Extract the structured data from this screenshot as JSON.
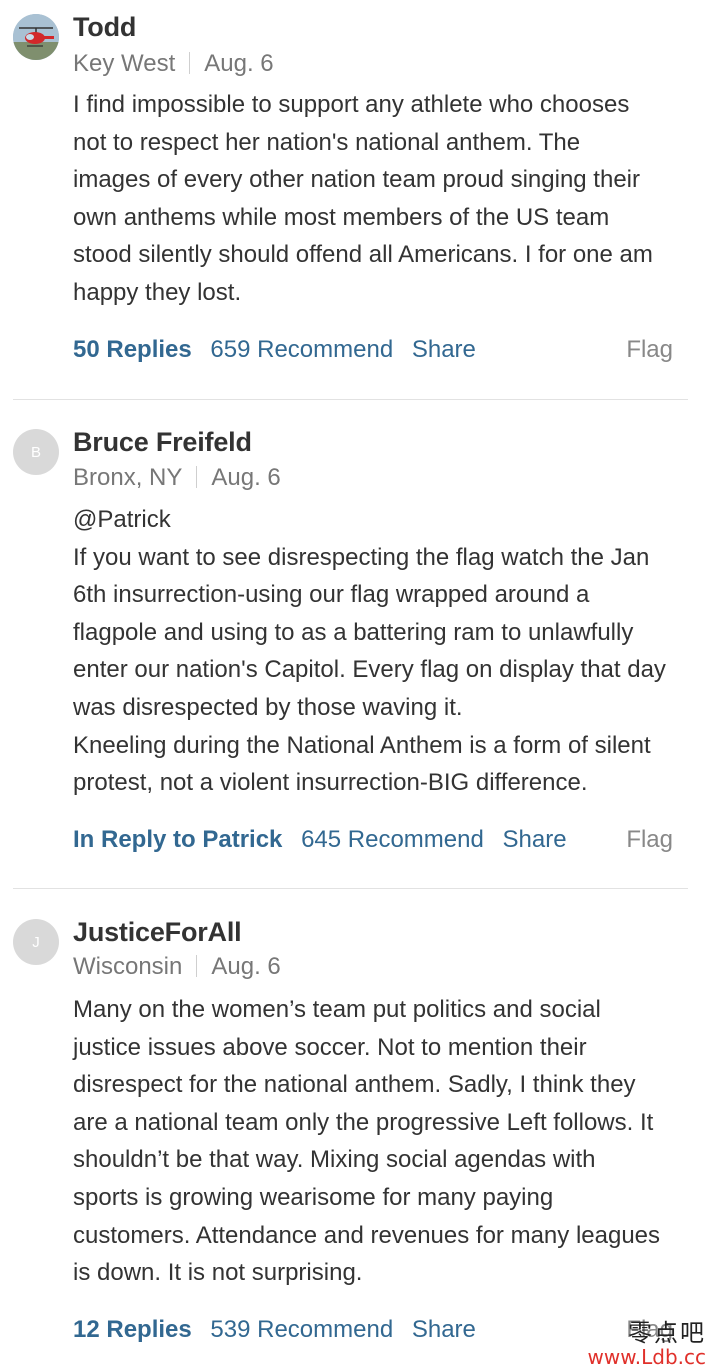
{
  "comments": [
    {
      "avatar_icon": "helicopter-photo-avatar",
      "author": "Todd",
      "location": "Key West",
      "date": "Aug. 6",
      "paragraphs": [
        "I find impossible to support any athlete who chooses\nnot to respect her nation's national anthem.  The\nimages of every other nation team proud singing their\nown anthems while most members of the US team\nstood silently should offend all Americans.  I for one am\nhappy they lost."
      ],
      "replies_label": "50 Replies",
      "recommend_label": "659 Recommend",
      "share_label": "Share",
      "flag_label": "Flag"
    },
    {
      "avatar_initial": "B",
      "author": "Bruce Freifeld",
      "location": "Bronx, NY",
      "date": "Aug. 6",
      "paragraphs": [
        "@Patrick\nIf you want to see disrespecting the flag watch the Jan\n6th insurrection-using our flag wrapped around a\nflagpole and using to as a battering ram to unlawfully\nenter our nation's Capitol. Every flag on display that day\nwas disrespected by those waving it.\nKneeling during the National Anthem is a form of silent\nprotest, not a violent insurrection-BIG difference."
      ],
      "reply_to_label": "In Reply to Patrick",
      "recommend_label": "645 Recommend",
      "share_label": "Share",
      "flag_label": "Flag"
    },
    {
      "avatar_initial": "J",
      "author": "JusticeForAll",
      "location": "Wisconsin",
      "date": "Aug. 6",
      "paragraphs": [
        "Many on the women’s team put politics and social\njustice issues above soccer.  Not to mention their\ndisrespect for the national anthem.   Sadly, I think they\nare a national team only the progressive Left follows. It\nshouldn’t be that way. Mixing social agendas with\nsports is growing wearisome for many paying\ncustomers.  Attendance and revenues for many leagues\nis down. It is not surprising."
      ],
      "replies_label": "12 Replies",
      "recommend_label": "539 Recommend",
      "share_label": "Share",
      "flag_label": "Flag"
    }
  ],
  "watermark": {
    "chinese": "零点吧",
    "url": "www.Ldb.cc"
  },
  "colors": {
    "link": "#326891",
    "meta": "#777777",
    "text": "#333333",
    "flag": "#888888",
    "divider": "#e2e2e2"
  }
}
